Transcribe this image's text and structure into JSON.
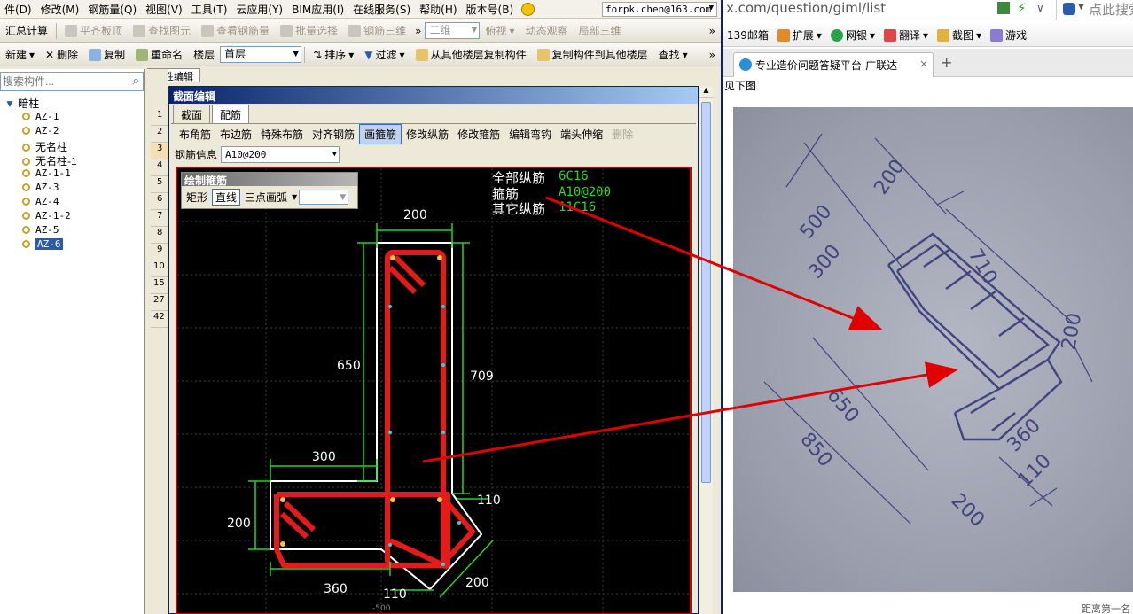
{
  "menu": [
    "件(D)",
    "修改(M)",
    "钢筋量(Q)",
    "视图(V)",
    "工具(T)",
    "云应用(Y)",
    "BIM应用(I)",
    "在线服务(S)",
    "帮助(H)",
    "版本号(B)"
  ],
  "account": "forpk.chen@163.com",
  "toolbar1": {
    "calc": "汇总计算",
    "items": [
      "平齐板顶",
      "查找图元",
      "查看钢筋量",
      "批量选择",
      "钢筋三维"
    ],
    "view2d": "二维",
    "items2": [
      "俯视",
      "动态观察",
      "局部三维"
    ]
  },
  "toolbar2": {
    "new": "新建",
    "delete": "删除",
    "copy": "复制",
    "rename": "重命名",
    "floor_label": "楼层",
    "floor_value": "首层",
    "sort": "排序",
    "filter": "过滤",
    "copy_from": "从其他楼层复制构件",
    "copy_to": "复制构件到其他楼层",
    "find": "查找"
  },
  "search": {
    "placeholder": "搜索构件..."
  },
  "tree": {
    "root": "暗柱",
    "items": [
      "AZ-1",
      "AZ-2",
      "无名柱",
      "无名柱-1",
      "AZ-1-1",
      "AZ-3",
      "AZ-4",
      "AZ-1-2",
      "AZ-5",
      "AZ-6"
    ],
    "selected": "AZ-6"
  },
  "property_tab": "属性编辑",
  "row_numbers": [
    "1",
    "2",
    "3",
    "4",
    "5",
    "6",
    "7",
    "8",
    "9",
    "10",
    "15",
    "27",
    "42"
  ],
  "dialog": {
    "title": "截面编辑",
    "tabs": [
      "截面",
      "配筋"
    ],
    "commands": [
      "布角筋",
      "布边筋",
      "特殊布筋",
      "对齐钢筋",
      "画箍筋",
      "修改纵筋",
      "修改箍筋",
      "编辑弯钩",
      "端头伸缩",
      "删除"
    ],
    "rebar_info_label": "钢筋信息",
    "rebar_info_value": "A10@200",
    "palette": {
      "title": "绘制箍筋",
      "buttons": [
        "矩形",
        "直线",
        "三点画弧"
      ]
    },
    "legend": [
      {
        "label": "全部纵筋",
        "value": "6C16"
      },
      {
        "label": "箍筋",
        "value": "A10@200"
      },
      {
        "label": "其它纵筋",
        "value": "11C16"
      }
    ],
    "dims": [
      "200",
      "650",
      "709",
      "300",
      "200",
      "110",
      "360",
      "110",
      "200"
    ],
    "bottom_mark": "-500"
  },
  "browser": {
    "address": "x.com/question/giml/list",
    "search_hint": "点此搜索",
    "toolbar": [
      "139邮箱",
      "扩展",
      "网银",
      "翻译",
      "截图",
      "游戏"
    ],
    "tab_title": "专业造价问题答疑平台-广联达",
    "page_text": "见下图",
    "footer_text": "距离第一名",
    "photo_dims": [
      "500",
      "200",
      "300",
      "710",
      "200",
      "650",
      "850",
      "360",
      "110",
      "200"
    ]
  },
  "colors": {
    "canvas_bg": "#000000",
    "rebar_red": "#e31b1b",
    "dim_green": "#24d624",
    "legend_green": "#22dd22",
    "arrow_red": "#e00000",
    "sketch_blue": "#41457e"
  }
}
